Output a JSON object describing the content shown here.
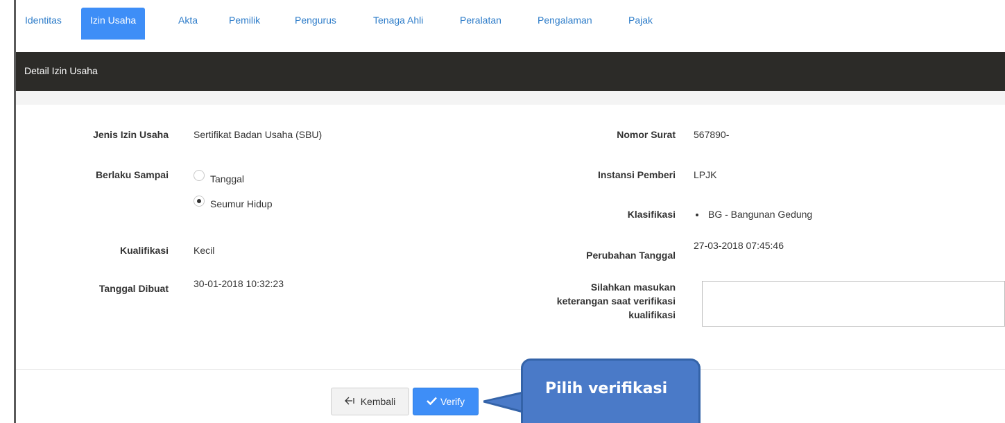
{
  "tabs": [
    "Identitas",
    "Izin Usaha",
    "Akta",
    "Pemilik",
    "Pengurus",
    "Tenaga Ahli",
    "Peralatan",
    "Pengalaman",
    "Pajak"
  ],
  "panel": {
    "title": "Detail Izin Usaha"
  },
  "left": {
    "jenis_label": "Jenis Izin Usaha",
    "jenis_value": "Sertifikat Badan Usaha (SBU)",
    "berlaku_label": "Berlaku Sampai",
    "opt_tanggal": "Tanggal",
    "opt_seumur": "Seumur Hidup",
    "kualifikasi_label": "Kualifikasi",
    "kualifikasi_value": "Kecil",
    "dibuat_label": "Tanggal Dibuat",
    "dibuat_value": "30-01-2018 10:32:23"
  },
  "right": {
    "nomor_label": "Nomor Surat",
    "nomor_value": "567890-",
    "instansi_label": "Instansi Pemberi",
    "instansi_value": "LPJK",
    "klasifikasi_label": "Klasifikasi",
    "klasifikasi_value": "BG - Bangunan Gedung",
    "perubahan_label": "Perubahan Tanggal",
    "perubahan_value": "27-03-2018 07:45:46",
    "ket_label_1": "Silahkan masukan",
    "ket_label_2": "keterangan saat verifikasi",
    "ket_label_3": "kualifikasi",
    "ket_value": ""
  },
  "buttons": {
    "back": "Kembali",
    "verify": "Verify"
  },
  "callout": "Pilih verifikasi",
  "colors": {
    "accent": "#3e8ef7",
    "header": "#2c2b28",
    "callout": "#4a7ac8"
  }
}
